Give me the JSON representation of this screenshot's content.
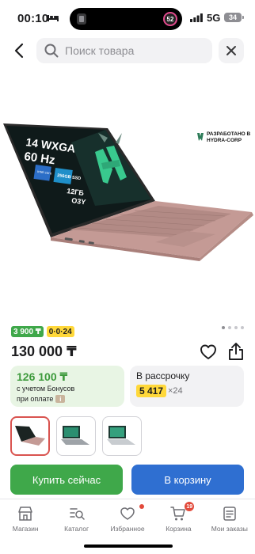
{
  "status_bar": {
    "time": "00:10",
    "network": "5G",
    "battery": "34",
    "island_badge": "52"
  },
  "search": {
    "placeholder": "Поиск товара"
  },
  "product_image": {
    "screen_line1": "14 WXGA",
    "screen_line2": "60 Hz",
    "cpu_label": "intel core",
    "ssd_label": "256GB SSD",
    "ram_label": "12ГБ",
    "os_label": "O3Y",
    "brand_line1": "РАЗРАБОТАНО В",
    "brand_line2": "HYDRA-CORP"
  },
  "badges": {
    "bonus": "3 900 ₸",
    "installment": "0·0·24"
  },
  "price": "130 000 ₸",
  "bonus_card": {
    "price": "126 100 ₸",
    "note1": "с учетом Бонусов",
    "note2": "при оплате",
    "info": "i"
  },
  "installment_card": {
    "title": "В рассрочку",
    "amount": "5 417",
    "term": "×24"
  },
  "buttons": {
    "buy": "Купить сейчас",
    "cart": "В корзину"
  },
  "tabs": [
    {
      "label": "Магазин"
    },
    {
      "label": "Каталог"
    },
    {
      "label": "Избранное"
    },
    {
      "label": "Корзина",
      "count": "19"
    },
    {
      "label": "Мои заказы"
    }
  ],
  "colors": {
    "green": "#3fa84a",
    "blue": "#2f6fd1",
    "yellow": "#ffd83a",
    "laptop": "#c49a95"
  }
}
